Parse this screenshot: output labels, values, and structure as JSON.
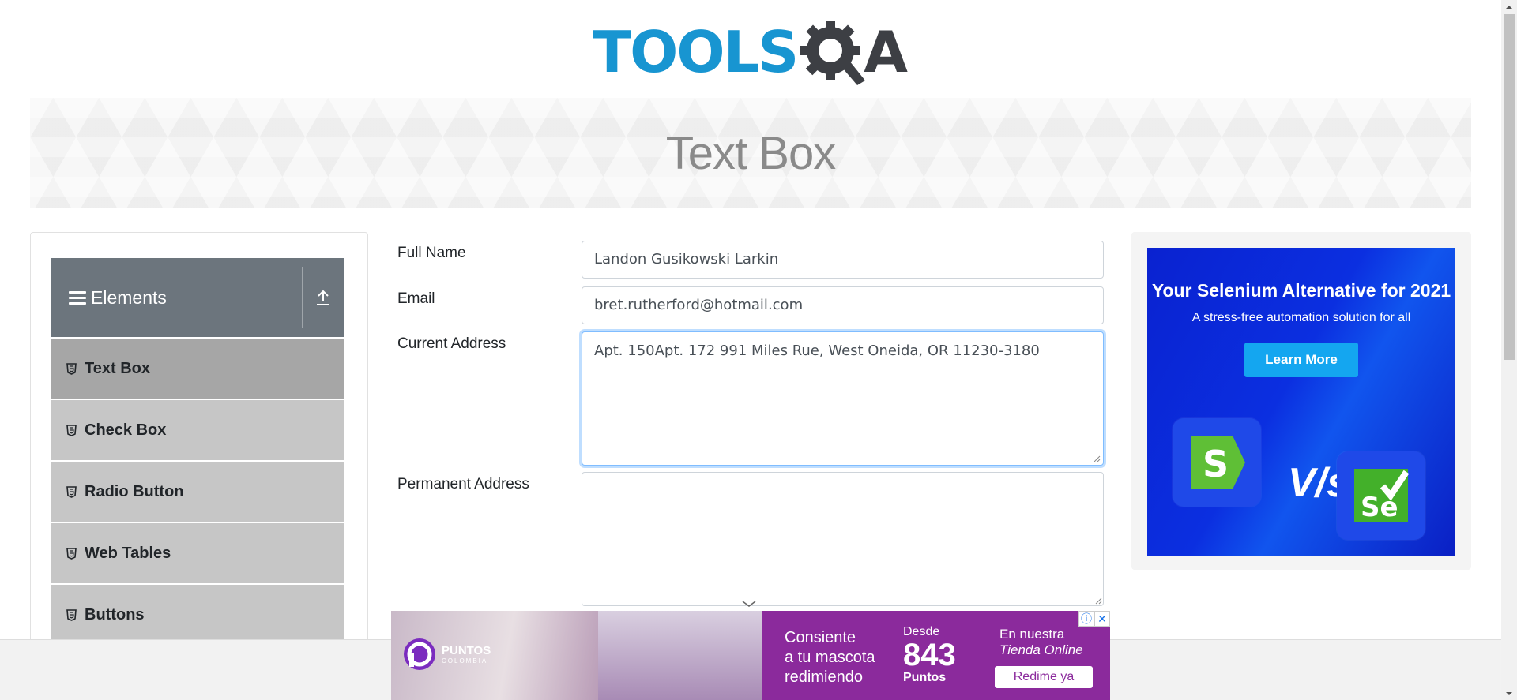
{
  "header": {
    "logo_main": "TOOLS",
    "logo_suffix": "A"
  },
  "banner": {
    "title": "Text Box"
  },
  "sidebar": {
    "group_title": "Elements",
    "items": [
      {
        "label": "Text Box",
        "active": true
      },
      {
        "label": "Check Box",
        "active": false
      },
      {
        "label": "Radio Button",
        "active": false
      },
      {
        "label": "Web Tables",
        "active": false
      },
      {
        "label": "Buttons",
        "active": false
      }
    ]
  },
  "form": {
    "full_name": {
      "label": "Full Name",
      "value": "Landon Gusikowski Larkin"
    },
    "email": {
      "label": "Email",
      "value": "bret.rutherford@hotmail.com"
    },
    "current_address": {
      "label": "Current Address",
      "value": "Apt. 150Apt. 172 991 Miles Rue, West Oneida, OR 11230-3180"
    },
    "permanent_address": {
      "label": "Permanent Address",
      "value": ""
    }
  },
  "ad_right": {
    "headline": "Your Selenium Alternative for 2021",
    "subtitle": "A stress-free automation solution for all",
    "cta": "Learn More",
    "vs_text": "V/s",
    "left_logo": "S",
    "right_logo": "Se"
  },
  "ad_bottom": {
    "brand": "PUNTOS",
    "brand_sub": "COLOMBIA",
    "line1": "Consiente",
    "line2": "a tu mascota",
    "line3": "redimiendo",
    "desde": "Desde",
    "points_value": "843",
    "points_label": "Puntos",
    "store_line1": "En nuestra",
    "store_line2": "Tienda Online",
    "cta": "Redime ya"
  },
  "colors": {
    "brand_blue": "#1895d1",
    "sidebar_header": "#6c757d",
    "active_item": "#a6a6a6",
    "focus_border": "#80bdff"
  }
}
